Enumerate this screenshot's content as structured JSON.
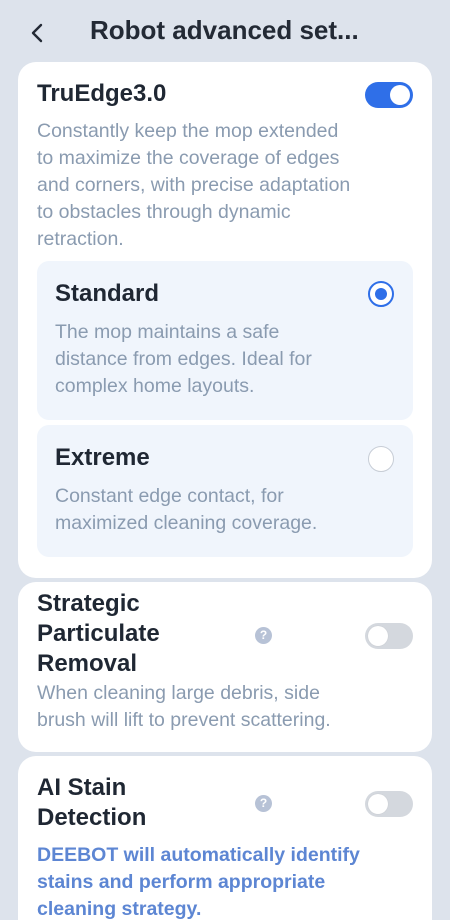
{
  "header": {
    "title": "Robot advanced set..."
  },
  "truedge": {
    "title": "TruEdge3.0",
    "enabled": true,
    "description": [
      "Constantly keep the mop extended",
      "to maximize the coverage of edges",
      "and corners, with precise adaptation",
      "to obstacles through dynamic",
      "retraction."
    ],
    "options": [
      {
        "label": "Standard",
        "selected": true,
        "description": [
          "The mop maintains a safe",
          "distance from edges. Ideal for",
          "complex home layouts."
        ]
      },
      {
        "label": "Extreme",
        "selected": false,
        "description": [
          "Constant edge contact, for",
          "maximized cleaning coverage."
        ]
      }
    ]
  },
  "particulate": {
    "title": [
      "Strategic",
      "Particulate",
      "Removal"
    ],
    "enabled": false,
    "help": "?",
    "description": [
      "When cleaning large debris, side",
      "brush will lift to prevent scattering."
    ]
  },
  "stain": {
    "title": [
      "AI Stain",
      "Detection"
    ],
    "enabled": false,
    "help": "?",
    "description": [
      "DEEBOT will automatically identify",
      "stains and perform appropriate",
      "cleaning strategy."
    ]
  },
  "colors": {
    "accent": "#2f6fe8",
    "background": "#dde3ec",
    "option_bg": "#f0f5fc"
  }
}
